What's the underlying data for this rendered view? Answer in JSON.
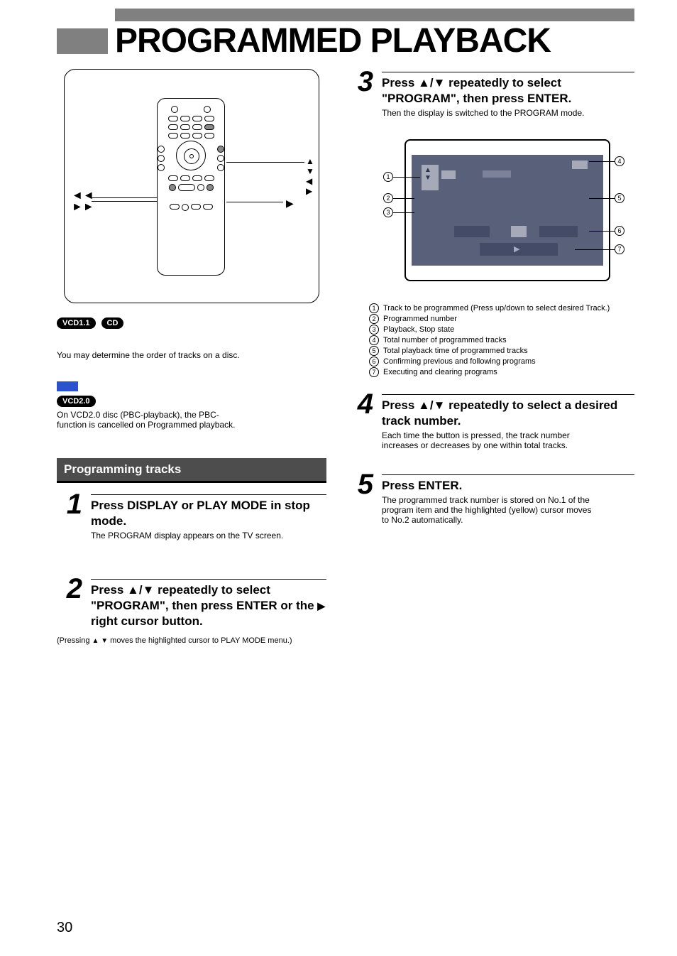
{
  "page_number": "30",
  "title": "PROGRAMMED PLAYBACK",
  "badges": {
    "vcd11": "VCD1.1",
    "cd": "CD",
    "vcd20": "VCD2.0"
  },
  "vcd20_note_line1": "On VCD2.0 disc (PBC-playback), the PBC-",
  "vcd20_note_line2": "function is cancelled on Programmed playback.",
  "programming_heading": "Programming tracks",
  "remote_labels": {
    "arrows": "▲ ▼ ◀ ▶",
    "play": "▶",
    "skip": "◄◄ ►►"
  },
  "steps": {
    "s1": {
      "num": "1",
      "text": "Press DISPLAY or PLAY MODE in stop mode.",
      "note": "The PROGRAM display appears on the TV screen."
    },
    "s2": {
      "num": "2",
      "text_pre": "Press ",
      "text_mid": " repeatedly to select \"PROGRAM\", then press ENTER or the ",
      "text_post": " right cursor button."
    },
    "s2_foot_pre": "(Pressing ",
    "s2_foot_post": " moves the highlighted cursor to PLAY MODE menu.)",
    "s3": {
      "num": "3",
      "text_pre": "Press ",
      "text_post": " repeatedly to select \"PROGRAM\", then press ENTER.",
      "note": "Then the display is switched to the PROGRAM mode."
    },
    "s4": {
      "num": "4",
      "text_pre": "Press ",
      "text_post": " repeatedly to select a desired track number.",
      "note_line1": "Each time the button is pressed, the track number",
      "note_line2": "increases or decreases by one within total tracks."
    },
    "s5": {
      "num": "5",
      "text": "Press ENTER.",
      "note_line1": "The programmed track number is stored on No.1 of the",
      "note_line2": "program item and the highlighted (yellow) cursor moves",
      "note_line3": "to No.2 automatically."
    }
  },
  "legend": {
    "l1": "Track to be programmed (Press up/down to select desired Track.)",
    "l2": "Programmed number",
    "l3": "Playback, Stop state",
    "l4": "Total number of programmed tracks",
    "l5": "Total playback time of programmed tracks",
    "l6": "Confirming previous and following programs",
    "l7": "Executing and clearing programs"
  }
}
